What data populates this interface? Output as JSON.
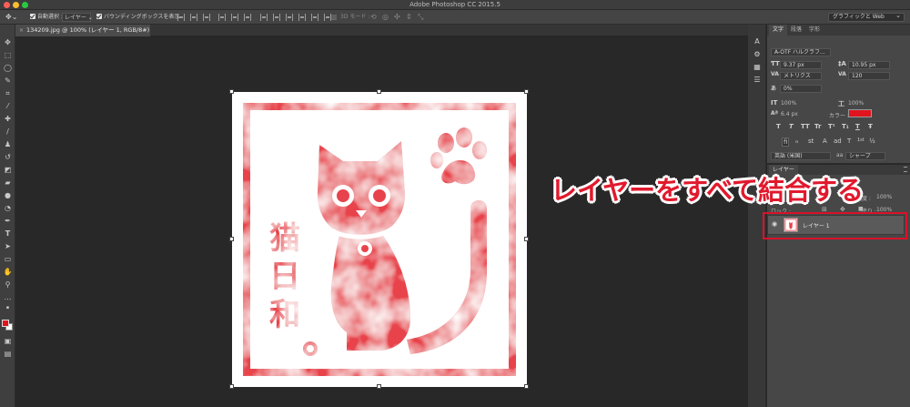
{
  "window": {
    "title": "Adobe Photoshop CC 2015.5"
  },
  "options_bar": {
    "auto_select_label": "自動選択 :",
    "auto_select_target": "レイヤー",
    "bounding_box_label": "バウンディングボックスを表示",
    "mode_3d_label": "3D モード :",
    "workspace": "グラフィックと Web"
  },
  "document": {
    "tab_label": "134209.jpg @ 100% (レイヤー 1, RGB/8#) *",
    "close_glyph": "×",
    "artwork_text": "猫日和。"
  },
  "character_panel": {
    "tabs": [
      "文字",
      "段落",
      "字形"
    ],
    "font_family": "A-OTF ハルクラフ...",
    "font_size": "9.37 px",
    "leading": "10.95 px",
    "kerning": "メトリクス",
    "tracking": "120",
    "tsume": "0%",
    "vertical_scale": "100%",
    "horizontal_scale": "100%",
    "baseline_shift": "6.4 px",
    "color_label": "カラー :",
    "color": "#e0141e",
    "style_buttons": [
      "T",
      "T",
      "TT",
      "Tr",
      "T¹",
      "T₁",
      "T",
      "Ŧ"
    ],
    "opentype_buttons": [
      "fi",
      "ℴ",
      "st",
      "A",
      "ad",
      "T",
      "1st",
      "½"
    ],
    "language": "英語 (米国)",
    "antialias": "シャープ"
  },
  "layers_panel": {
    "tab": "レイヤー",
    "opacity_label": "不透明度 :",
    "opacity": "100%",
    "lock_label": "ロック :",
    "fill_label": "塗り :",
    "fill": "100%",
    "layers": [
      {
        "name": "レイヤー 1",
        "visible": true
      }
    ]
  },
  "annotation": {
    "text": "レイヤーをすべて結合する"
  },
  "colors": {
    "accent_red": "#e1192d",
    "foreground": "#e0141e",
    "background": "#ffffff"
  }
}
